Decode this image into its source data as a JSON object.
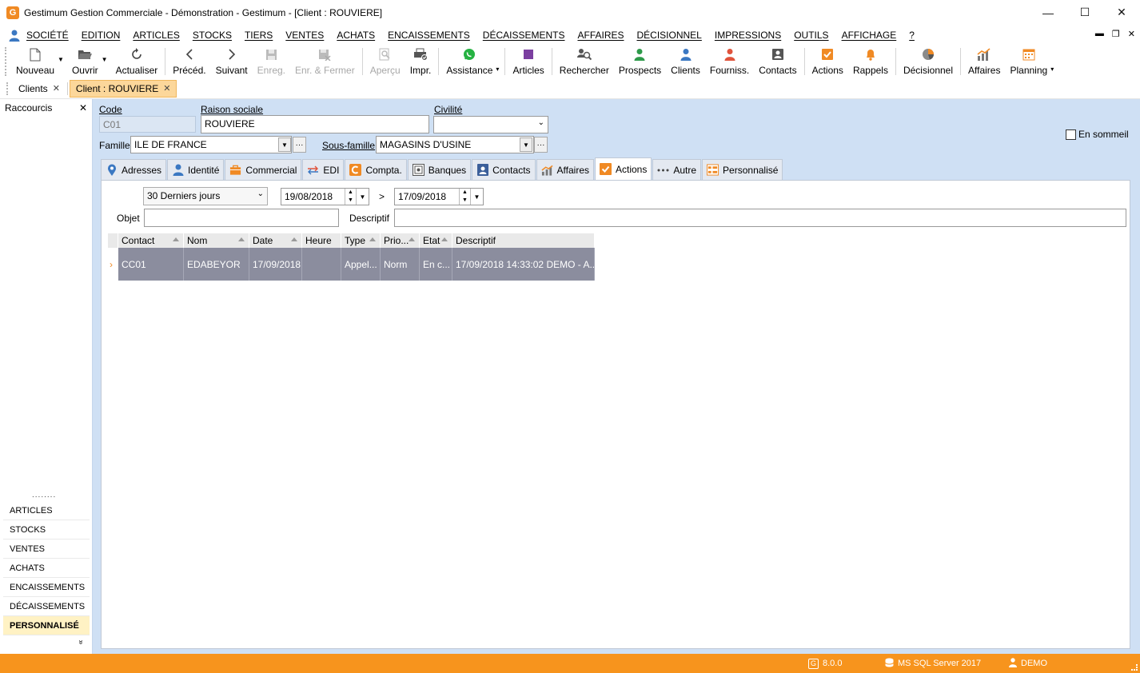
{
  "window": {
    "title": "Gestimum Gestion Commerciale - Démonstration - Gestimum - [Client : ROUVIERE]",
    "logo": "G",
    "minimize": "—",
    "maximize": "☐",
    "close": "✕"
  },
  "menu": {
    "items": [
      "SOCIÉTÉ",
      "EDITION",
      "ARTICLES",
      "STOCKS",
      "TIERS",
      "VENTES",
      "ACHATS",
      "ENCAISSEMENTS",
      "DÉCAISSEMENTS",
      "AFFAIRES",
      "DÉCISIONNEL",
      "IMPRESSIONS",
      "OUTILS",
      "AFFICHAGE",
      "?"
    ]
  },
  "toolbar": {
    "buttons": [
      {
        "label": "Nouveau",
        "icon": "new-document-icon"
      },
      {
        "label": "Ouvrir",
        "icon": "folder-open-icon"
      },
      {
        "label": "Actualiser",
        "icon": "refresh-icon"
      },
      {
        "label": "Précéd.",
        "icon": "chevron-left-icon"
      },
      {
        "label": "Suivant",
        "icon": "chevron-right-icon"
      },
      {
        "label": "Enreg.",
        "icon": "save-icon"
      },
      {
        "label": "Enr. & Fermer",
        "icon": "save-close-icon"
      },
      {
        "label": "Aperçu",
        "icon": "preview-icon"
      },
      {
        "label": "Impr.",
        "icon": "print-icon"
      },
      {
        "label": "Assistance",
        "icon": "whatsapp-icon"
      },
      {
        "label": "Articles",
        "icon": "articles-icon"
      },
      {
        "label": "Rechercher",
        "icon": "search-icon"
      },
      {
        "label": "Prospects",
        "icon": "prospect-icon"
      },
      {
        "label": "Clients",
        "icon": "client-icon"
      },
      {
        "label": "Fourniss.",
        "icon": "supplier-icon"
      },
      {
        "label": "Contacts",
        "icon": "contact-card-icon"
      },
      {
        "label": "Actions",
        "icon": "check-icon"
      },
      {
        "label": "Rappels",
        "icon": "bell-icon"
      },
      {
        "label": "Décisionnel",
        "icon": "pie-chart-icon"
      },
      {
        "label": "Affaires",
        "icon": "bar-chart-icon"
      },
      {
        "label": "Planning",
        "icon": "calendar-icon"
      }
    ]
  },
  "doc_tabs": [
    {
      "label": "Clients"
    },
    {
      "label": "Client : ROUVIERE"
    }
  ],
  "sidebar": {
    "title": "Raccourcis",
    "dots": "........",
    "items": [
      "ARTICLES",
      "STOCKS",
      "VENTES",
      "ACHATS",
      "ENCAISSEMENTS",
      "DÉCAISSEMENTS",
      "PERSONNALISÉ"
    ],
    "more": "»"
  },
  "form": {
    "code_label": "Code",
    "code_value": "C01",
    "raison_label": "Raison sociale",
    "raison_value": "ROUVIERE",
    "civilite_label": "Civilité",
    "civilite_value": "",
    "famille_label": "Famille",
    "famille_value": "ILE DE FRANCE",
    "sousfamille_label": "Sous-famille",
    "sousfamille_value": "MAGASINS D'USINE",
    "ensommeil_label": "En sommeil",
    "ellipsis": "···"
  },
  "tabs": [
    {
      "label": "Adresses"
    },
    {
      "label": "Identité"
    },
    {
      "label": "Commercial"
    },
    {
      "label": "EDI"
    },
    {
      "label": "Compta."
    },
    {
      "label": "Banques"
    },
    {
      "label": "Contacts"
    },
    {
      "label": "Affaires"
    },
    {
      "label": "Actions"
    },
    {
      "label": "Autre"
    },
    {
      "label": "Personnalisé"
    }
  ],
  "filters": {
    "period": "30 Derniers jours",
    "date_from": "19/08/2018",
    "sep": ">",
    "date_to": "17/09/2018",
    "objet_label": "Objet",
    "objet_value": "",
    "descriptif_label": "Descriptif",
    "descriptif_value": ""
  },
  "grid": {
    "columns": [
      "Contact",
      "Nom",
      "Date",
      "Heure",
      "Type",
      "Prio...",
      "Etat",
      "Descriptif"
    ],
    "rows": [
      {
        "indicator": "›",
        "cells": [
          "CC01",
          "EDABEYOR",
          "17/09/2018",
          "",
          "Appel...",
          "Norm",
          "En c...",
          "17/09/2018 14:33:02 DEMO - A..."
        ]
      }
    ]
  },
  "status": {
    "version": "8.0.0",
    "db": "MS SQL Server 2017",
    "user": "DEMO"
  }
}
